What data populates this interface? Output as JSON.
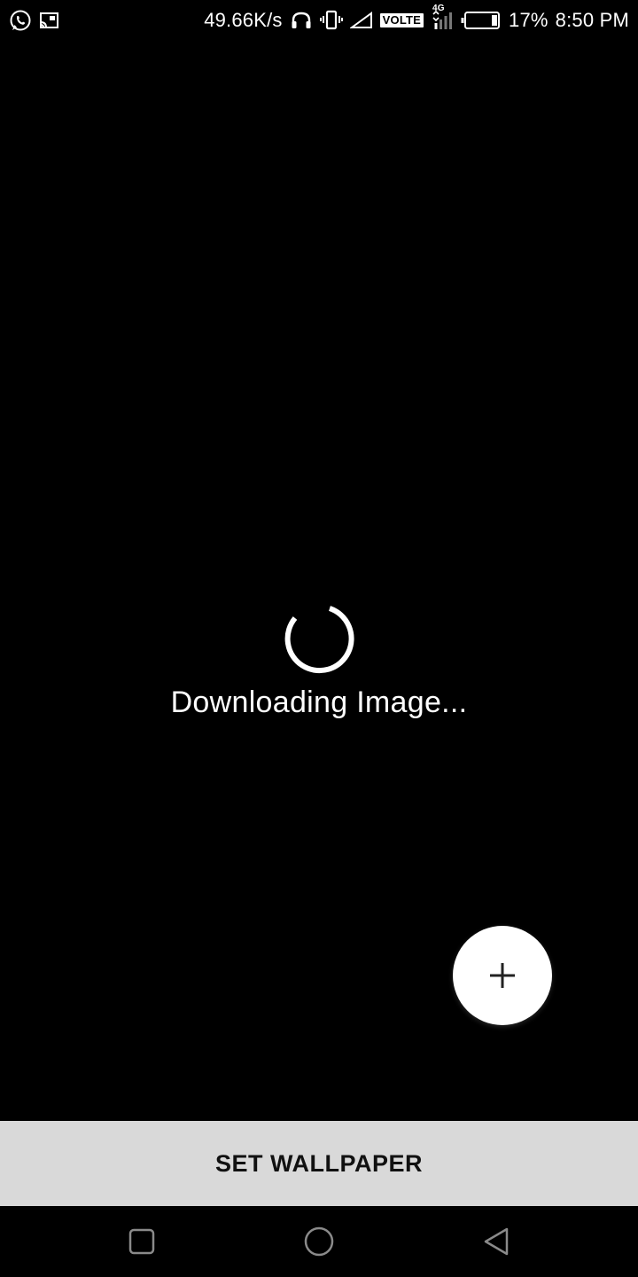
{
  "status_bar": {
    "network_speed": "49.66K/s",
    "network_type": "4G",
    "volte_label": "VOLTE",
    "battery_percent": "17%",
    "battery_level": 0.17,
    "time": "8:50 PM",
    "left_icons": [
      "whatsapp-icon",
      "cast-icon"
    ],
    "right_icons": [
      "headset-icon",
      "vibrate-icon",
      "signal-icon",
      "volte-icon",
      "data-signal-icon",
      "battery-icon"
    ]
  },
  "loading": {
    "text": "Downloading Image..."
  },
  "fab": {
    "icon": "plus-icon"
  },
  "action": {
    "label": "SET WALLPAPER"
  },
  "nav_bar": {
    "icons": [
      "recents-square-icon",
      "home-circle-icon",
      "back-triangle-icon"
    ]
  },
  "colors": {
    "background": "#000000",
    "foreground": "#ffffff",
    "action_bar": "#d9d9d9",
    "action_text": "#111111",
    "nav_icon": "#8a8a8a"
  }
}
